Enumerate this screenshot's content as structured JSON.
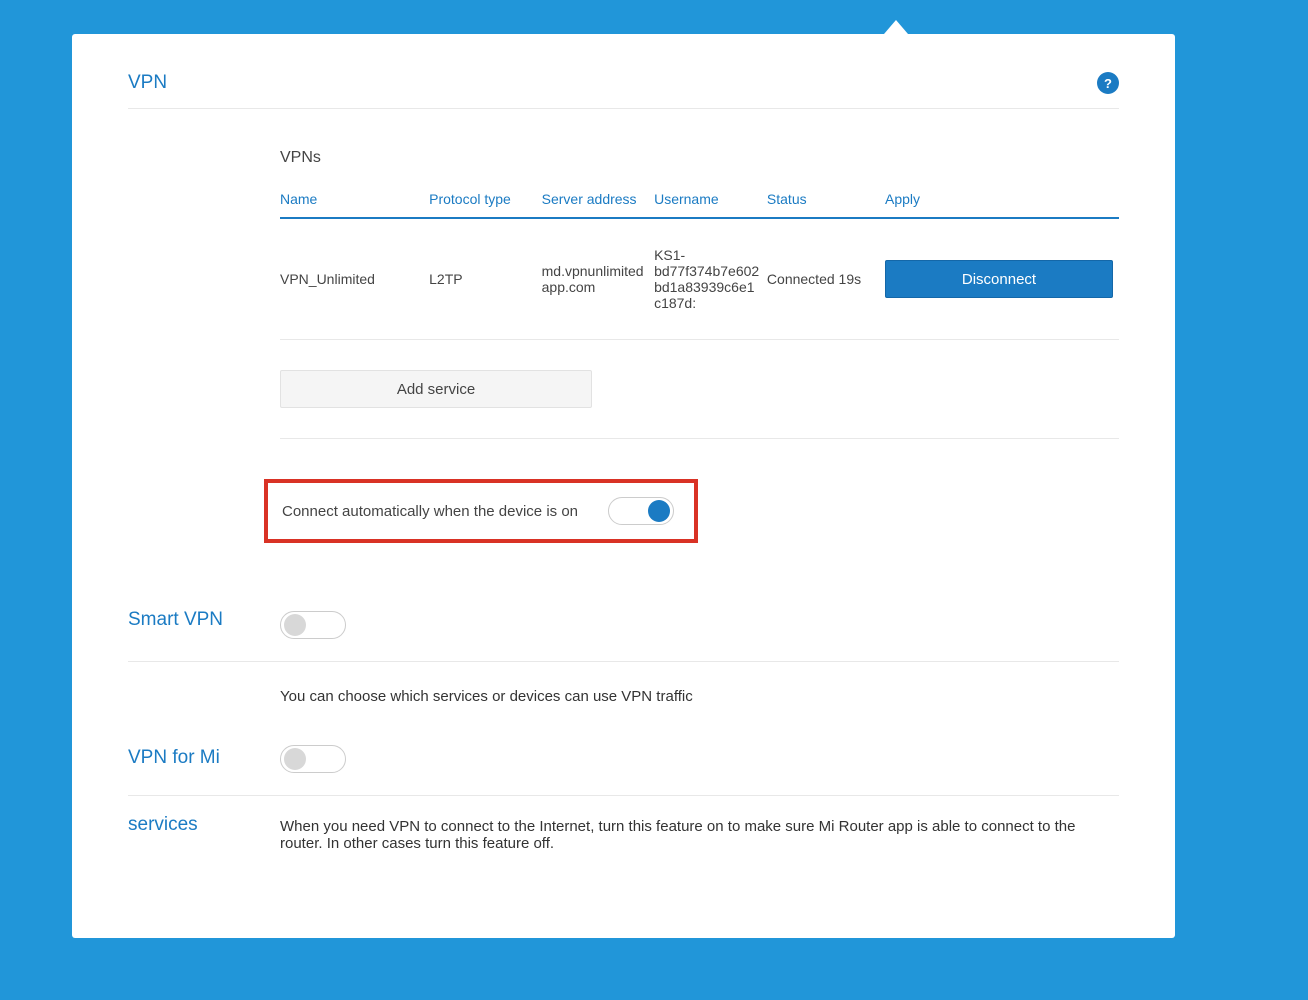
{
  "page": {
    "title": "VPN"
  },
  "vpns": {
    "subtitle": "VPNs",
    "headers": {
      "name": "Name",
      "protocol": "Protocol type",
      "server": "Server address",
      "username": "Username",
      "status": "Status",
      "apply": "Apply"
    },
    "row": {
      "name": "VPN_Unlimited",
      "protocol": "L2TP",
      "server": "md.vpnunlimitedapp.com",
      "username": "KS1-bd77f374b7e602bd1a83939c6e1c187d:",
      "status": "Connected 19s",
      "action": "Disconnect"
    },
    "add_button": "Add service"
  },
  "auto_connect": {
    "label": "Connect automatically when the device is on"
  },
  "smart_vpn": {
    "title": "Smart VPN",
    "desc": "You can choose which services or devices can use VPN traffic"
  },
  "mi_services": {
    "title_line1": "VPN for Mi",
    "title_line2": "services",
    "desc": "When you need VPN to connect to the Internet, turn this feature on to make sure Mi Router app is able to connect to the router. In other cases turn this feature off."
  },
  "help_icon_text": "?"
}
